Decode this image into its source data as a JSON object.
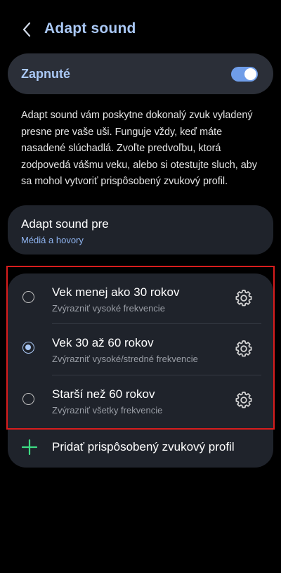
{
  "header": {
    "back_icon": "chevron-left-icon",
    "title": "Adapt sound"
  },
  "toggle": {
    "label": "Zapnuté",
    "state": "on",
    "accent_color": "#6f9de8"
  },
  "description": "Adapt sound vám poskytne dokonalý zvuk vyladený presne pre vaše uši. Funguje vždy, keď máte nasadené slúchadlá. Zvoľte predvoľbu, ktorá zodpovedá vášmu veku, alebo si otestujte sluch, aby sa mohol vytvoriť prispôsobený zvukový profil.",
  "adapt_for": {
    "title": "Adapt sound pre",
    "value": "Médiá a hovory"
  },
  "options": [
    {
      "title": "Vek menej ako 30 rokov",
      "subtitle": "Zvýrazniť vysoké frekvencie",
      "selected": false,
      "icon": "gear-icon"
    },
    {
      "title": "Vek 30 až 60 rokov",
      "subtitle": "Zvýrazniť vysoké/stredné frekvencie",
      "selected": true,
      "icon": "gear-icon"
    },
    {
      "title": "Starší než 60 rokov",
      "subtitle": "Zvýrazniť všetky frekvencie",
      "selected": false,
      "icon": "gear-icon"
    }
  ],
  "add_profile": {
    "label": "Pridať prispôsobený zvukový profil",
    "icon": "plus-icon",
    "icon_color": "#3ddc84"
  },
  "colors": {
    "title_accent": "#aac8f5",
    "highlight_border": "#d81d1d"
  }
}
